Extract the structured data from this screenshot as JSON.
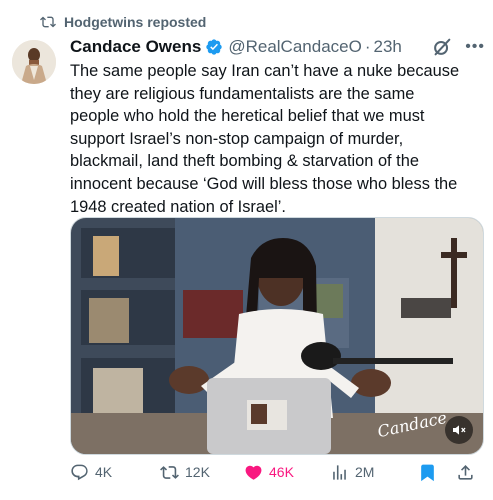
{
  "repost": {
    "text": "Hodgetwins reposted"
  },
  "author": {
    "name": "Candace Owens",
    "handle": "@RealCandaceO",
    "separator": "·",
    "time": "23h"
  },
  "tweet": {
    "text": "The same people say Iran can’t have a nuke because\nthey are religious fundamentalists are the same\npeople who hold the heretical belief that we must\nsupport Israel’s non-stop campaign of murder,\nblackmail, land theft bombing & starvation of the\ninnocent because ‘God will bless those who bless the\n1948 created nation of Israel’."
  },
  "media": {
    "watermark": "Candace"
  },
  "actions": {
    "replies": "4K",
    "reposts": "12K",
    "likes": "46K",
    "views": "2M"
  },
  "colors": {
    "text": "#0f1419",
    "secondary": "#536471",
    "verified": "#1d9bf0",
    "like": "#f91880",
    "bookmark": "#1d9bf0"
  },
  "icons": [
    "repost-icon",
    "verified-badge-icon",
    "grok-icon",
    "more-icon",
    "reply-icon",
    "like-icon",
    "views-icon",
    "bookmark-icon",
    "share-icon",
    "mute-icon"
  ]
}
